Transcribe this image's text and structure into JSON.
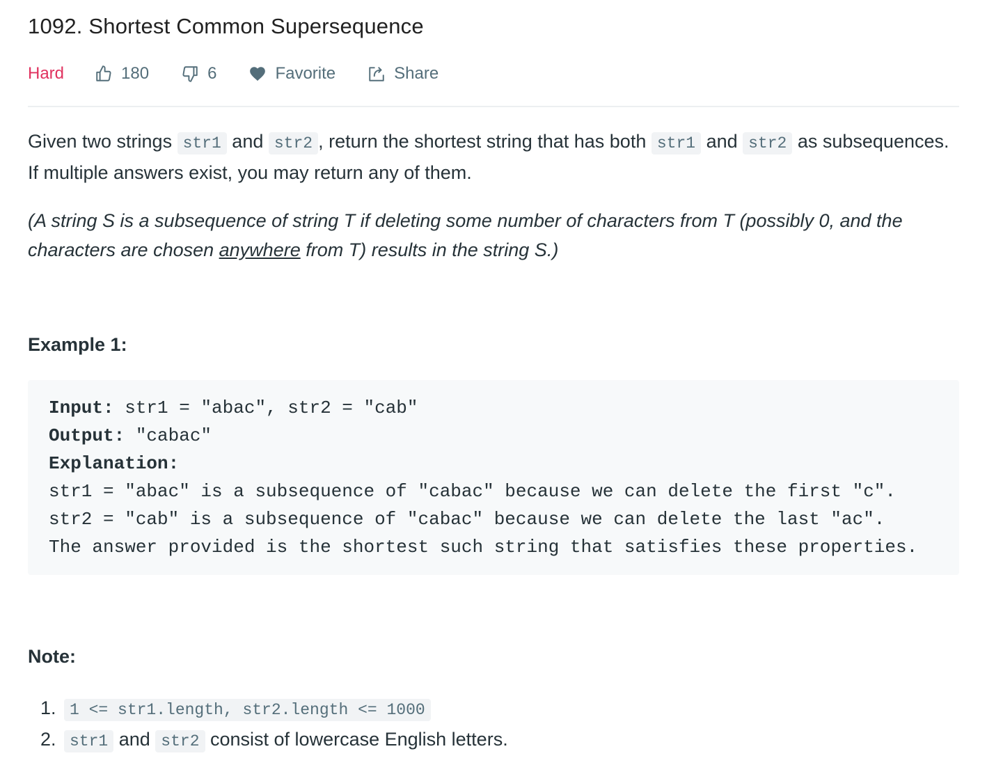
{
  "problem": {
    "title": "1092. Shortest Common Supersequence",
    "difficulty": "Hard",
    "likes": "180",
    "dislikes": "6",
    "favorite_label": "Favorite",
    "share_label": "Share"
  },
  "colors": {
    "difficulty_hard": "#e0325f",
    "meta_text": "#546e7a",
    "code_bg": "#f7f9fa"
  },
  "icons": {
    "like": "thumbs-up-icon",
    "dislike": "thumbs-down-icon",
    "favorite": "heart-icon",
    "share": "share-icon"
  },
  "description": {
    "p1_t1": "Given two strings ",
    "p1_c1": "str1",
    "p1_t2": " and ",
    "p1_c2": "str2",
    "p1_t3": ", return the shortest string that has both ",
    "p1_c3": "str1",
    "p1_t4": " and ",
    "p1_c4": "str2",
    "p1_t5": " as subsequences.  If multiple answers exist, you may return any of them.",
    "p2_t1": "(A string S is a subsequence of string T if deleting some number of characters from T (possibly 0, and the characters are chosen ",
    "p2_u": "anywhere",
    "p2_t2": " from T) results in the string S.)"
  },
  "example": {
    "heading": "Example 1:",
    "input_label": "Input:",
    "input_value": " str1 = \"abac\", str2 = \"cab\"",
    "output_label": "Output:",
    "output_value": " \"cabac\"",
    "explanation_label": "Explanation:",
    "explanation_lines": [
      "str1 = \"abac\" is a subsequence of \"cabac\" because we can delete the first \"c\".",
      "str2 = \"cab\" is a subsequence of \"cabac\" because we can delete the last \"ac\".",
      "The answer provided is the shortest such string that satisfies these properties."
    ]
  },
  "notes": {
    "heading": "Note:",
    "item1_code": "1 <= str1.length, str2.length <= 1000",
    "item2_c1": "str1",
    "item2_t1": " and ",
    "item2_c2": "str2",
    "item2_t2": " consist of lowercase English letters."
  }
}
